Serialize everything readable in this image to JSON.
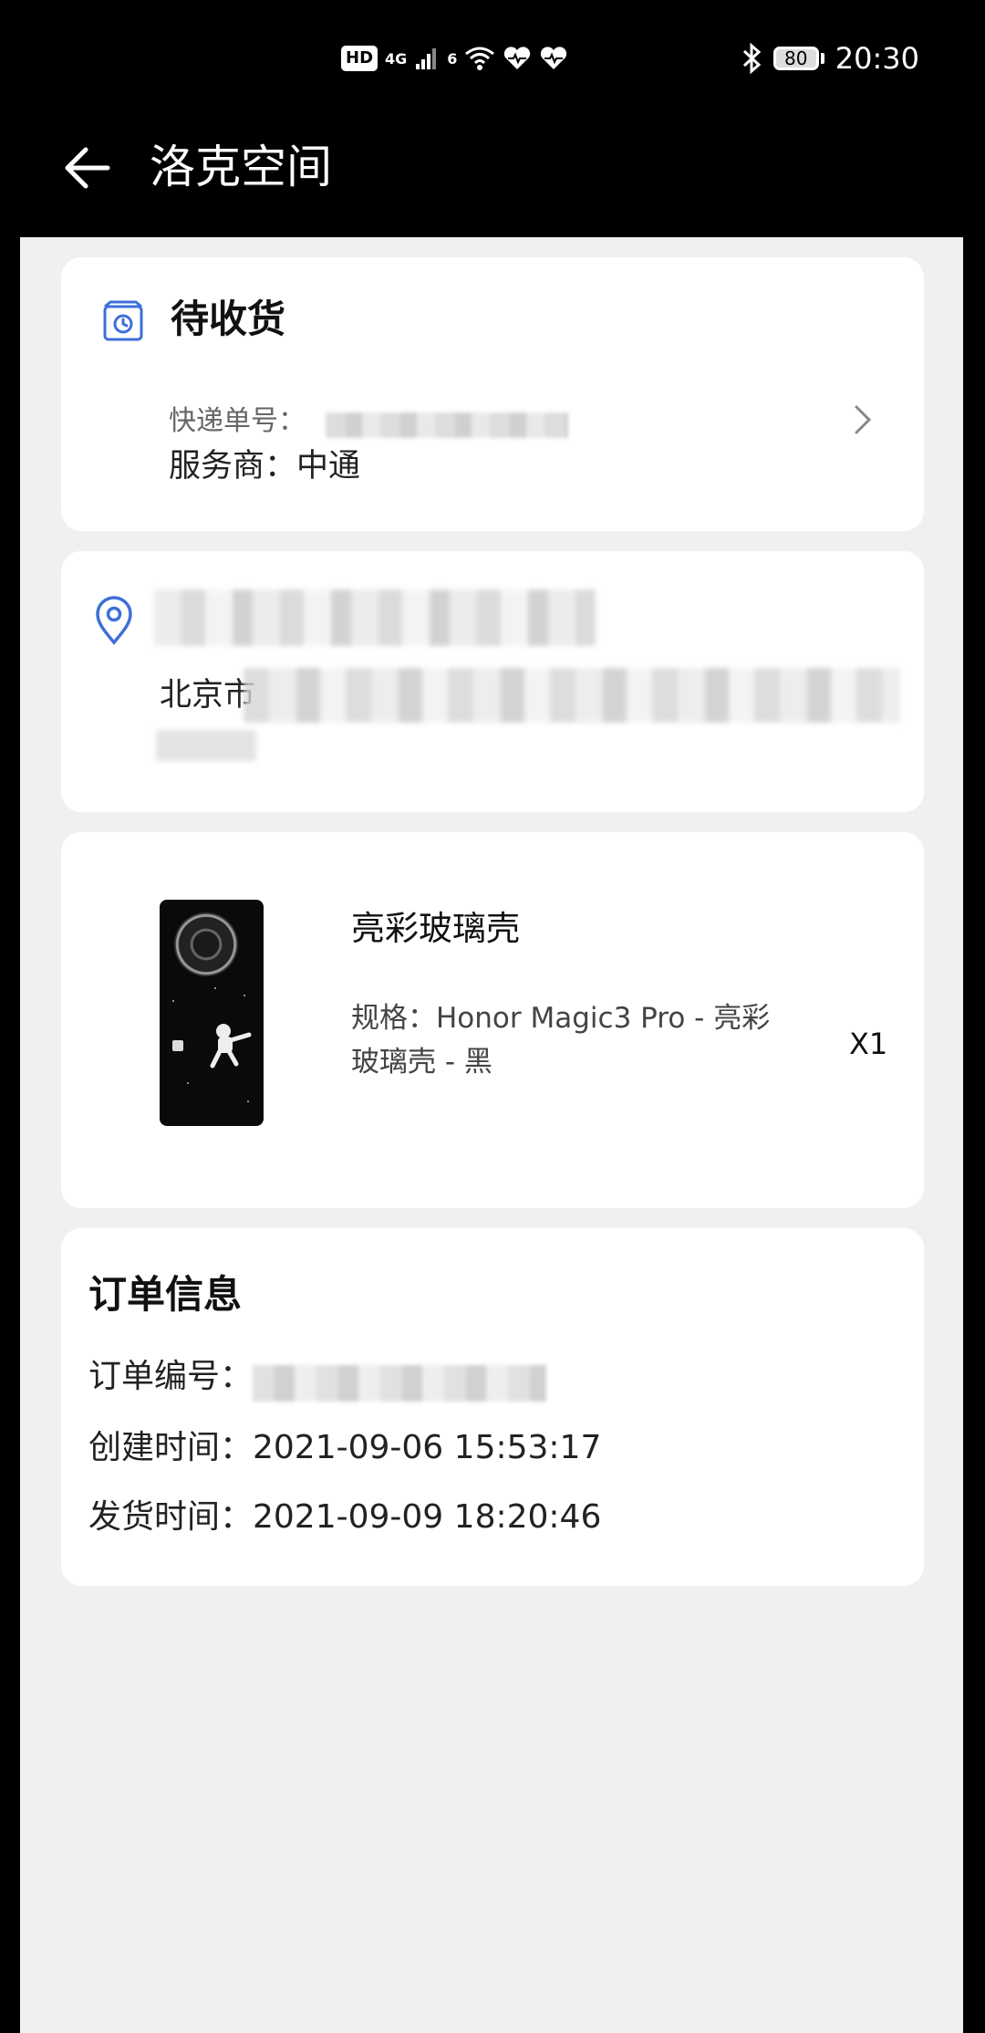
{
  "status_bar": {
    "network_badge": "HD",
    "signal_label": "4G",
    "wifi_label": "6",
    "battery": "80",
    "time": "20:30"
  },
  "app_bar": {
    "title": "洛克空间"
  },
  "shipment_card": {
    "status": "待收货",
    "tracking_label": "快递单号：",
    "carrier": "服务商：中通"
  },
  "address_card": {
    "address_prefix": "北京市"
  },
  "product_card": {
    "name": "亮彩玻璃壳",
    "spec": "规格：Honor Magic3 Pro - 亮彩玻璃壳 - 黑",
    "quantity": "X1"
  },
  "order_card": {
    "title": "订单信息",
    "order_number_label": "订单编号：",
    "created": "创建时间：2021-09-06 15:53:17",
    "shipped": "发货时间：2021-09-09 18:20:46"
  },
  "colors": {
    "accent": "#3d6fd8",
    "page_bg": "#eff0f2",
    "card_bg": "#ffffff",
    "header_bg": "#000000"
  },
  "icons": {
    "back": "arrow-left-icon",
    "package": "package-clock-icon",
    "location": "location-pin-icon",
    "chevron": "chevron-right-icon"
  }
}
